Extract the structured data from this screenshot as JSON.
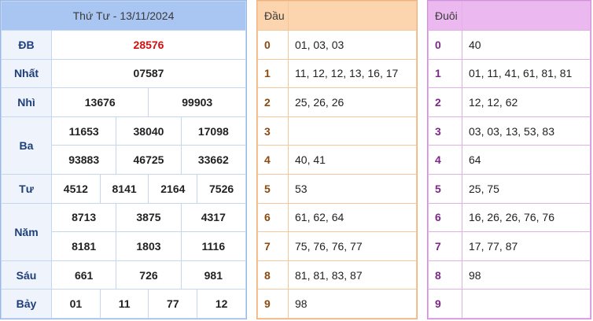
{
  "results": {
    "date_header": "Thứ Tư - 13/11/2024",
    "rows": {
      "db": {
        "label": "ĐB",
        "values": [
          "28576"
        ]
      },
      "nhat": {
        "label": "Nhất",
        "values": [
          "07587"
        ]
      },
      "nhi": {
        "label": "Nhì",
        "values": [
          "13676",
          "99903"
        ]
      },
      "ba": {
        "label": "Ba",
        "values": [
          "11653",
          "38040",
          "17098",
          "93883",
          "46725",
          "33662"
        ]
      },
      "tu": {
        "label": "Tư",
        "values": [
          "4512",
          "8141",
          "2164",
          "7526"
        ]
      },
      "nam": {
        "label": "Năm",
        "values": [
          "8713",
          "3875",
          "4317",
          "8181",
          "1803",
          "1116"
        ]
      },
      "sau": {
        "label": "Sáu",
        "values": [
          "661",
          "726",
          "981"
        ]
      },
      "bay": {
        "label": "Bảy",
        "values": [
          "01",
          "11",
          "77",
          "12"
        ]
      }
    }
  },
  "dau": {
    "header": "Đầu",
    "rows": [
      {
        "k": "0",
        "v": "01, 03, 03"
      },
      {
        "k": "1",
        "v": "11, 12, 12, 13, 16, 17"
      },
      {
        "k": "2",
        "v": "25, 26, 26"
      },
      {
        "k": "3",
        "v": ""
      },
      {
        "k": "4",
        "v": "40, 41"
      },
      {
        "k": "5",
        "v": "53"
      },
      {
        "k": "6",
        "v": "61, 62, 64"
      },
      {
        "k": "7",
        "v": "75, 76, 76, 77"
      },
      {
        "k": "8",
        "v": "81, 81, 83, 87"
      },
      {
        "k": "9",
        "v": "98"
      }
    ]
  },
  "duoi": {
    "header": "Đuôi",
    "rows": [
      {
        "k": "0",
        "v": "40"
      },
      {
        "k": "1",
        "v": "01, 11, 41, 61, 81, 81"
      },
      {
        "k": "2",
        "v": "12, 12, 62"
      },
      {
        "k": "3",
        "v": "03, 03, 13, 53, 83"
      },
      {
        "k": "4",
        "v": "64"
      },
      {
        "k": "5",
        "v": "25, 75"
      },
      {
        "k": "6",
        "v": "16, 26, 26, 76, 76"
      },
      {
        "k": "7",
        "v": "17, 77, 87"
      },
      {
        "k": "8",
        "v": "98"
      },
      {
        "k": "9",
        "v": ""
      }
    ]
  },
  "colors": {
    "special_prize": "#d01010",
    "results_header": "#a9c6f2",
    "dau_header": "#fcd4ad",
    "duoi_header": "#ebb8f0"
  }
}
